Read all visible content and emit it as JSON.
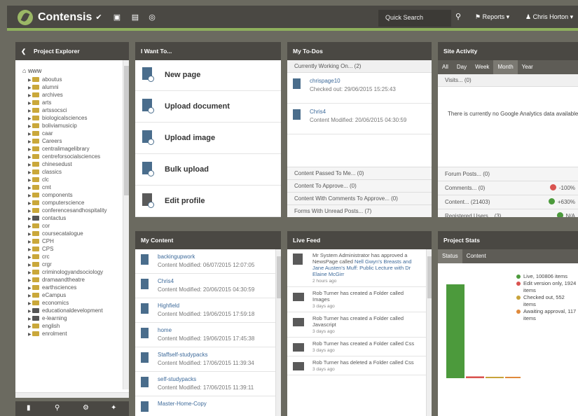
{
  "header": {
    "brand": "Contensis",
    "quick_search": "Quick Search",
    "reports": "Reports",
    "user": "Chris Horton"
  },
  "explorer": {
    "title": "Project Explorer",
    "root": "www",
    "items": [
      "aboutus",
      "alumni",
      "archives",
      "arts",
      "artssocsci",
      "biologicalsciences",
      "boliviamusicip",
      "caar",
      "Careers",
      "centralimagelibrary",
      "centreforsocialsciences",
      "chinesedust",
      "classics",
      "clc",
      "cmt",
      "components",
      "computerscience",
      "conferencesandhospitality",
      "contactus",
      "cor",
      "coursecatalogue",
      "CPH",
      "CPS",
      "crc",
      "crgr",
      "criminologyandsociology",
      "dramaandtheatre",
      "earthsciences",
      "eCampus",
      "economics",
      "educationaldevelopment",
      "e-learning",
      "english",
      "enrolment"
    ]
  },
  "iwant": {
    "title": "I Want To...",
    "items": [
      "New page",
      "Upload document",
      "Upload image",
      "Bulk upload",
      "Edit profile"
    ]
  },
  "todos": {
    "title": "My To-Dos",
    "working": "Currently Working On... (2)",
    "items": [
      {
        "name": "chrispage10",
        "meta": "Checked out: 29/06/2015 15:25:43"
      },
      {
        "name": "Chris4",
        "meta": "Content Modified: 20/06/2015 04:30:59"
      }
    ],
    "rows": [
      "Content Passed To Me... (0)",
      "Content To Approve... (0)",
      "Content With Comments To Approve... (0)",
      "Forms With Unread Posts... (7)"
    ]
  },
  "activity": {
    "title": "Site Activity",
    "tabs": [
      "All",
      "Day",
      "Week",
      "Month",
      "Year"
    ],
    "visits": "Visits... (0)",
    "message": "There is currently no Google Analytics data available",
    "rows": [
      {
        "label": "Forum Posts... (0)",
        "value": ""
      },
      {
        "label": "Comments... (0)",
        "value": "-100%"
      },
      {
        "label": "Content... (21403)",
        "value": "+630%"
      },
      {
        "label": "Registered Users... (3)",
        "value": "N/A"
      }
    ]
  },
  "mycontent": {
    "title": "My Content",
    "items": [
      {
        "name": "backingupwork",
        "meta": "Content Modified: 06/07/2015 12:07:05"
      },
      {
        "name": "Chris4",
        "meta": "Content Modified: 20/06/2015 04:30:59"
      },
      {
        "name": "Highfield",
        "meta": "Content Modified: 19/06/2015 17:59:18"
      },
      {
        "name": "home",
        "meta": "Content Modified: 19/06/2015 17:45:38"
      },
      {
        "name": "Staffself-studypacks",
        "meta": "Content Modified: 17/06/2015 11:39:34"
      },
      {
        "name": "self-studypacks",
        "meta": "Content Modified: 17/06/2015 11:39:11"
      },
      {
        "name": "Master-Home-Copy",
        "meta": ""
      }
    ]
  },
  "livefeed": {
    "title": "Live Feed",
    "items": [
      {
        "text": "Mr System Administrator has approved a NewsPage called ",
        "link": "Nell Gwyn's Breasts and Jane Austen's Muff: Public Lecture with Dr Elaine McGirr",
        "ago": "2 hours ago"
      },
      {
        "text": "Rob Turner has created a Folder called Images",
        "link": "",
        "ago": "3 days ago"
      },
      {
        "text": "Rob Turner has created a Folder called Javascript",
        "link": "",
        "ago": "3 days ago"
      },
      {
        "text": "Rob Turner has created a Folder called Css",
        "link": "",
        "ago": "3 days ago"
      },
      {
        "text": "Rob Turner has deleted a Folder called Css",
        "link": "",
        "ago": "3 days ago"
      }
    ]
  },
  "stats": {
    "title": "Project Stats",
    "tabs": [
      "Status",
      "Content"
    ],
    "legend": [
      {
        "label": "Live, 100806 items",
        "color": "#4c9a3c"
      },
      {
        "label": "Edit version only, 1924 items",
        "color": "#d9534f"
      },
      {
        "label": "Checked out, 552 items",
        "color": "#c8a33b"
      },
      {
        "label": "Awaiting approval, 117 items",
        "color": "#e08a3c"
      }
    ]
  },
  "chart_data": {
    "type": "bar",
    "categories": [
      "Live",
      "Edit version only",
      "Checked out",
      "Awaiting approval"
    ],
    "values": [
      100806,
      1924,
      552,
      117
    ]
  }
}
